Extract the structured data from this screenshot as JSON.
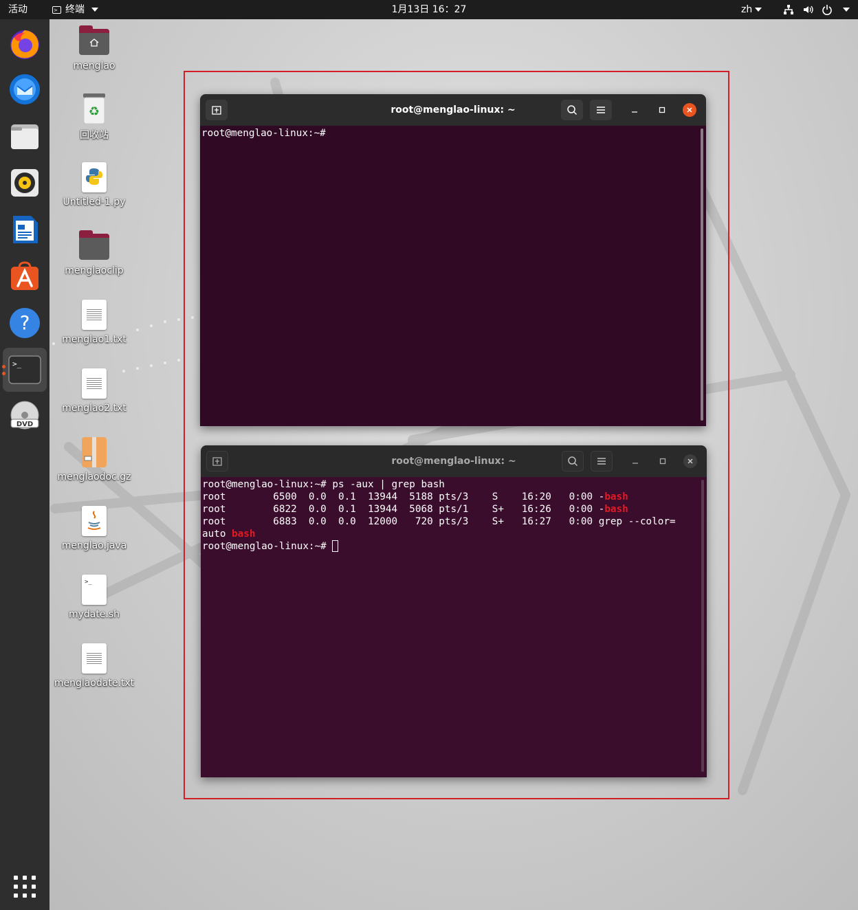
{
  "topbar": {
    "activities": "活动",
    "app_menu": "终端",
    "clock": "1月13日 16：27",
    "lang": "zh"
  },
  "dock": {
    "items": [
      {
        "name": "firefox"
      },
      {
        "name": "thunderbird"
      },
      {
        "name": "files"
      },
      {
        "name": "rhythmbox"
      },
      {
        "name": "libreoffice-writer"
      },
      {
        "name": "ubuntu-software"
      },
      {
        "name": "help"
      },
      {
        "name": "terminal",
        "active": true
      },
      {
        "name": "dvd"
      }
    ]
  },
  "desktop": {
    "icons": [
      {
        "label": "menglao",
        "type": "home-folder"
      },
      {
        "label": "回收站",
        "type": "trash"
      },
      {
        "label": "Untitled-1.py",
        "type": "python"
      },
      {
        "label": "menglaoclip",
        "type": "folder"
      },
      {
        "label": "menglao1.txt",
        "type": "text"
      },
      {
        "label": "menglao2.txt",
        "type": "text"
      },
      {
        "label": "menglaodoc.gz",
        "type": "archive"
      },
      {
        "label": "menglao.java",
        "type": "java"
      },
      {
        "label": "mydate.sh",
        "type": "script"
      },
      {
        "label": "menglaodate.txt",
        "type": "text"
      }
    ]
  },
  "terminal_top": {
    "title": "root@menglao-linux: ~",
    "lines": [
      "root@menglao-linux:~#"
    ]
  },
  "terminal_bottom": {
    "title": "root@menglao-linux: ~",
    "command_line": "root@menglao-linux:~# ps -aux | grep bash",
    "rows": [
      {
        "pre": "root        6500  0.0  0.1  13944  5188 pts/3    S    16:20   0:00 -",
        "match": "bash",
        "post": ""
      },
      {
        "pre": "root        6822  0.0  0.1  13944  5068 pts/1    S+   16:26   0:00 -",
        "match": "bash",
        "post": ""
      },
      {
        "pre": "root        6883  0.0  0.0  12000   720 pts/3    S+   16:27   0:00 grep --color=",
        "match": "",
        "post": ""
      },
      {
        "pre": "auto ",
        "match": "bash",
        "post": ""
      }
    ],
    "prompt": "root@menglao-linux:~# "
  },
  "colors": {
    "terminal_bg": "#300a24",
    "highlight_frame": "#d01f26",
    "ubuntu_orange": "#e95420"
  }
}
